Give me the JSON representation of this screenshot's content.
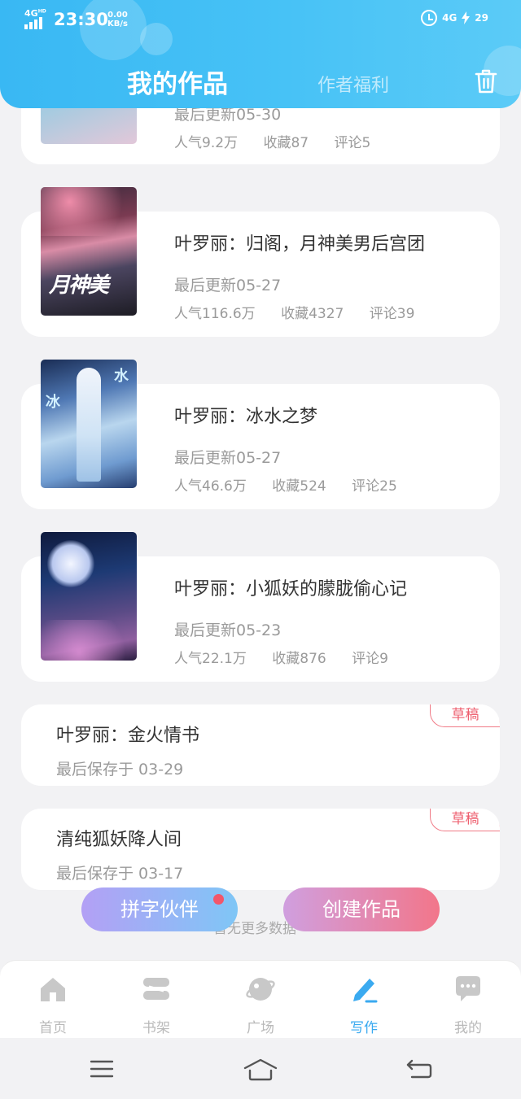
{
  "status_bar": {
    "network": "4G",
    "network_sup": "HD",
    "time": "23:30",
    "speed_value": "0.00",
    "speed_unit": "KB/s",
    "mobile_data": "4G",
    "battery": "29"
  },
  "header": {
    "tab_works": "我的作品",
    "tab_benefits": "作者福利",
    "trash_icon": "trash-icon"
  },
  "works": [
    {
      "title": "",
      "updated": "最后更新05-30",
      "popularity": "人气9.2万",
      "favorites": "收藏87",
      "comments": "评论5"
    },
    {
      "title": "叶罗丽：归阁，月神美男后宫团",
      "updated": "最后更新05-27",
      "popularity": "人气116.6万",
      "favorites": "收藏4327",
      "comments": "评论39"
    },
    {
      "title": "叶罗丽：冰水之梦",
      "updated": "最后更新05-27",
      "popularity": "人气46.6万",
      "favorites": "收藏524",
      "comments": "评论25"
    },
    {
      "title": "叶罗丽：小狐妖的朦胧偷心记",
      "updated": "最后更新05-23",
      "popularity": "人气22.1万",
      "favorites": "收藏876",
      "comments": "评论9"
    }
  ],
  "drafts": [
    {
      "title": "叶罗丽：金火情书",
      "saved": "最后保存于 03-29",
      "tag": "草稿"
    },
    {
      "title": "清纯狐妖降人间",
      "saved": "最后保存于 03-17",
      "tag": "草稿"
    }
  ],
  "footer_text": "暂无更多数据",
  "buttons": {
    "partner": "拼字伙伴",
    "create": "创建作品"
  },
  "nav": [
    {
      "label": "首页",
      "icon": "home-icon"
    },
    {
      "label": "书架",
      "icon": "bookshelf-icon"
    },
    {
      "label": "广场",
      "icon": "square-icon"
    },
    {
      "label": "写作",
      "icon": "pen-icon",
      "active": true
    },
    {
      "label": "我的",
      "icon": "chat-bubble-icon"
    }
  ],
  "colors": {
    "header_start": "#39b8f3",
    "header_end": "#5bcbf7",
    "active_nav": "#3aaaf0",
    "draft_tag": "#ee5f6f"
  }
}
